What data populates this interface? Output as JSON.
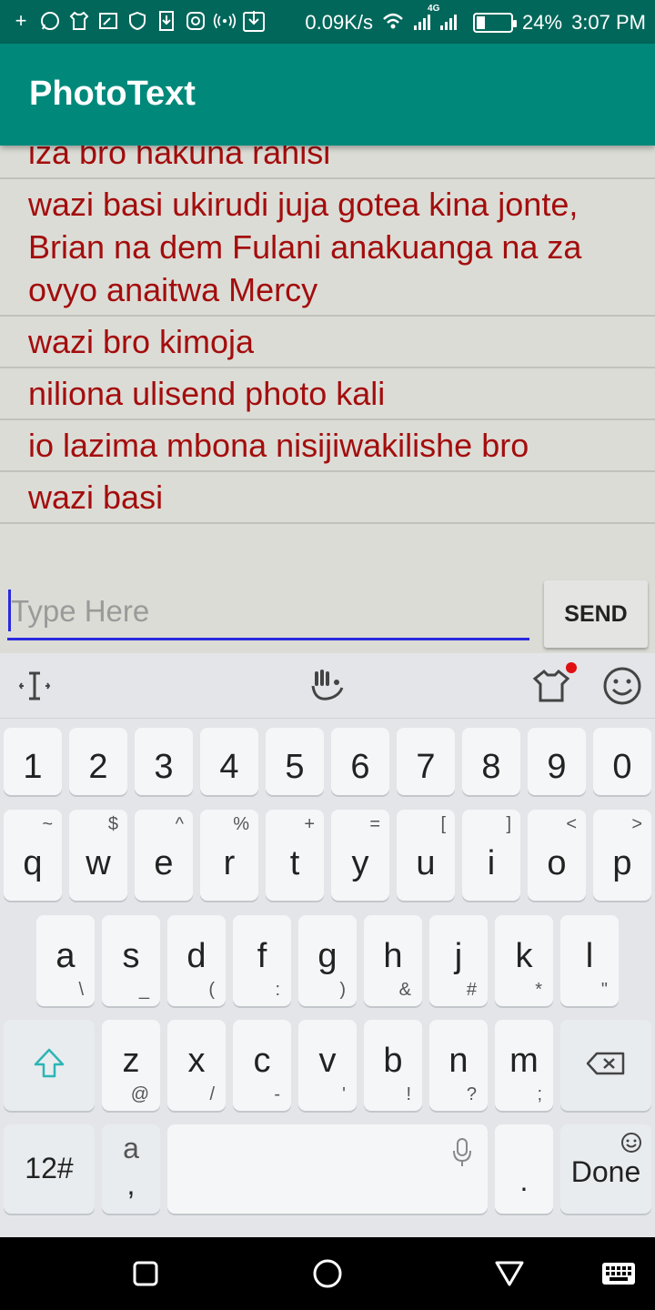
{
  "status_bar": {
    "speed": "0.09K/s",
    "network": "4G",
    "battery_percent": "24%",
    "battery_level": 0.24,
    "time": "3:07 PM"
  },
  "app": {
    "title": "PhotoText"
  },
  "messages": [
    "iza bro hakuna rahisi",
    "wazi basi ukirudi juja gotea kina jonte, Brian na dem Fulani anakuanga na za ovyo anaitwa Mercy",
    "wazi bro kimoja",
    "niliona ulisend photo kali",
    "io lazima mbona nisijiwakilishe bro",
    "wazi basi"
  ],
  "composer": {
    "placeholder": "Type Here",
    "send_label": "SEND"
  },
  "colors": {
    "status_bar": "#00675a",
    "app_bar": "#00897b",
    "message_text": "#a30d0d",
    "input_underline": "#2a2ae0"
  },
  "keyboard": {
    "toolbar_icons": [
      "text-cursor-icon",
      "voice-hand-icon",
      "theme-shirt-icon",
      "emoji-icon"
    ],
    "number_row": [
      "1",
      "2",
      "3",
      "4",
      "5",
      "6",
      "7",
      "8",
      "9",
      "0"
    ],
    "row1": [
      {
        "key": "q",
        "sub": "~"
      },
      {
        "key": "w",
        "sub": "$"
      },
      {
        "key": "e",
        "sub": "^"
      },
      {
        "key": "r",
        "sub": "%"
      },
      {
        "key": "t",
        "sub": "+"
      },
      {
        "key": "y",
        "sub": "="
      },
      {
        "key": "u",
        "sub": "["
      },
      {
        "key": "i",
        "sub": "]"
      },
      {
        "key": "o",
        "sub": "<"
      },
      {
        "key": "p",
        "sub": ">"
      }
    ],
    "row2": [
      {
        "key": "a",
        "sub": "\\"
      },
      {
        "key": "s",
        "sub": "_"
      },
      {
        "key": "d",
        "sub": "("
      },
      {
        "key": "f",
        "sub": ":"
      },
      {
        "key": "g",
        "sub": ")"
      },
      {
        "key": "h",
        "sub": "&"
      },
      {
        "key": "j",
        "sub": "#"
      },
      {
        "key": "k",
        "sub": "*"
      },
      {
        "key": "l",
        "sub": "\""
      }
    ],
    "row3": [
      {
        "key": "z",
        "sub": "@"
      },
      {
        "key": "x",
        "sub": "/"
      },
      {
        "key": "c",
        "sub": "-"
      },
      {
        "key": "v",
        "sub": "'"
      },
      {
        "key": "b",
        "sub": "!"
      },
      {
        "key": "n",
        "sub": "?"
      },
      {
        "key": "m",
        "sub": ";"
      }
    ],
    "symbols_label": "12#",
    "lang_key": {
      "top": "a",
      "bottom": ","
    },
    "period": ".",
    "done_label": "Done"
  },
  "navbar_icons": [
    "recents-square-icon",
    "home-circle-icon",
    "back-triangle-icon",
    "keyboard-icon"
  ]
}
